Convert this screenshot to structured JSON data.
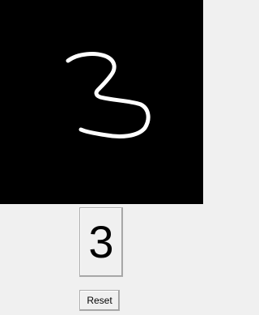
{
  "drawing_canvas": {
    "background": "#000000",
    "stroke_color": "#ffffff",
    "drawn_content": "3"
  },
  "prediction": {
    "value": "3"
  },
  "controls": {
    "reset_label": "Reset"
  }
}
